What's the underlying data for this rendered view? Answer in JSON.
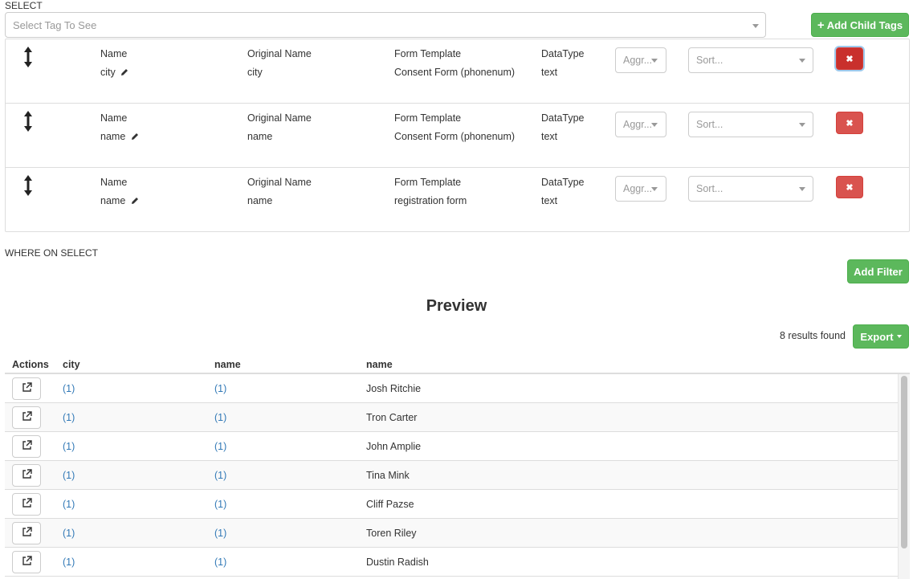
{
  "select": {
    "label": "SELECT",
    "placeholder": "Select Tag To See",
    "add_child_tags": "Add Child Tags"
  },
  "tag_headers": {
    "name": "Name",
    "original_name": "Original Name",
    "form_template": "Form Template",
    "datatype": "DataType"
  },
  "tags": [
    {
      "name": "city",
      "original_name": "city",
      "form_template": "Consent Form (phonenum)",
      "datatype": "text",
      "aggregate": "Aggr...",
      "sort": "Sort..."
    },
    {
      "name": "name",
      "original_name": "name",
      "form_template": "Consent Form (phonenum)",
      "datatype": "text",
      "aggregate": "Aggr...",
      "sort": "Sort..."
    },
    {
      "name": "name",
      "original_name": "name",
      "form_template": "registration form",
      "datatype": "text",
      "aggregate": "Aggr...",
      "sort": "Sort..."
    }
  ],
  "where": {
    "label": "WHERE ON SELECT",
    "add_filter": "Add Filter"
  },
  "preview": {
    "title": "Preview",
    "results": "8 results found",
    "export": "Export"
  },
  "table": {
    "columns": [
      "Actions",
      "city",
      "name",
      "name"
    ],
    "rows": [
      {
        "city": "(1)",
        "name": "(1)",
        "person": "Josh Ritchie"
      },
      {
        "city": "(1)",
        "name": "(1)",
        "person": "Tron Carter"
      },
      {
        "city": "(1)",
        "name": "(1)",
        "person": "John Amplie"
      },
      {
        "city": "(1)",
        "name": "(1)",
        "person": "Tina Mink"
      },
      {
        "city": "(1)",
        "name": "(1)",
        "person": "Cliff Pazse"
      },
      {
        "city": "(1)",
        "name": "(1)",
        "person": "Toren Riley"
      },
      {
        "city": "(1)",
        "name": "(1)",
        "person": "Dustin Radish"
      }
    ]
  },
  "icons": {
    "drag": "vertical-resize-arrow-icon",
    "edit": "pencil-icon",
    "remove": "times-icon",
    "open": "external-link-icon",
    "add": "plus-icon"
  },
  "colors": {
    "success": "#5cb85c",
    "danger": "#d9534f",
    "link": "#337ab7"
  }
}
